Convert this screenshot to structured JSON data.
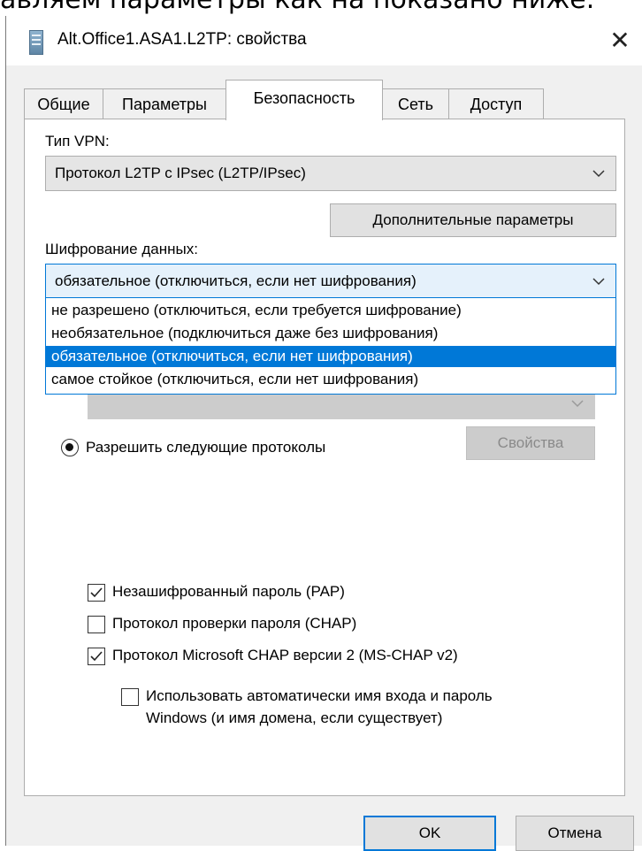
{
  "page_text": "авляем параметры как на показано ниже.",
  "window": {
    "title": "Alt.Office1.ASA1.L2TP: свойства",
    "close_glyph": "✕"
  },
  "tabs": [
    {
      "label": "Общие"
    },
    {
      "label": "Параметры"
    },
    {
      "label": "Безопасность"
    },
    {
      "label": "Сеть"
    },
    {
      "label": "Доступ"
    }
  ],
  "vpn": {
    "label": "Тип VPN:",
    "value": "Протокол L2TP с IPsec (L2TP/IPsec)"
  },
  "advanced_button": "Дополнительные параметры",
  "encryption": {
    "label": "Шифрование данных:",
    "value": "обязательное (отключиться, если нет шифрования)",
    "options": [
      "не разрешено (отключиться, если требуется шифрование)",
      "необязательное (подключиться даже без шифрования)",
      "обязательное (отключиться, если нет шифрования)",
      "самое стойкое (отключиться, если нет шифрования)"
    ],
    "selected_index": 2
  },
  "auth": {
    "radio_label": "Разрешить следующие протоколы",
    "properties_button": "Свойства",
    "pap": "Незашифрованный пароль (PAP)",
    "chap": "Протокол проверки пароля (CHAP)",
    "mschap": "Протокол Microsoft CHAP версии 2 (MS-CHAP v2)",
    "autologon_line1": "Использовать автоматически имя входа и пароль",
    "autologon_line2": "Windows (и имя домена, если существует)"
  },
  "buttons": {
    "ok": "OK",
    "cancel": "Отмена"
  }
}
